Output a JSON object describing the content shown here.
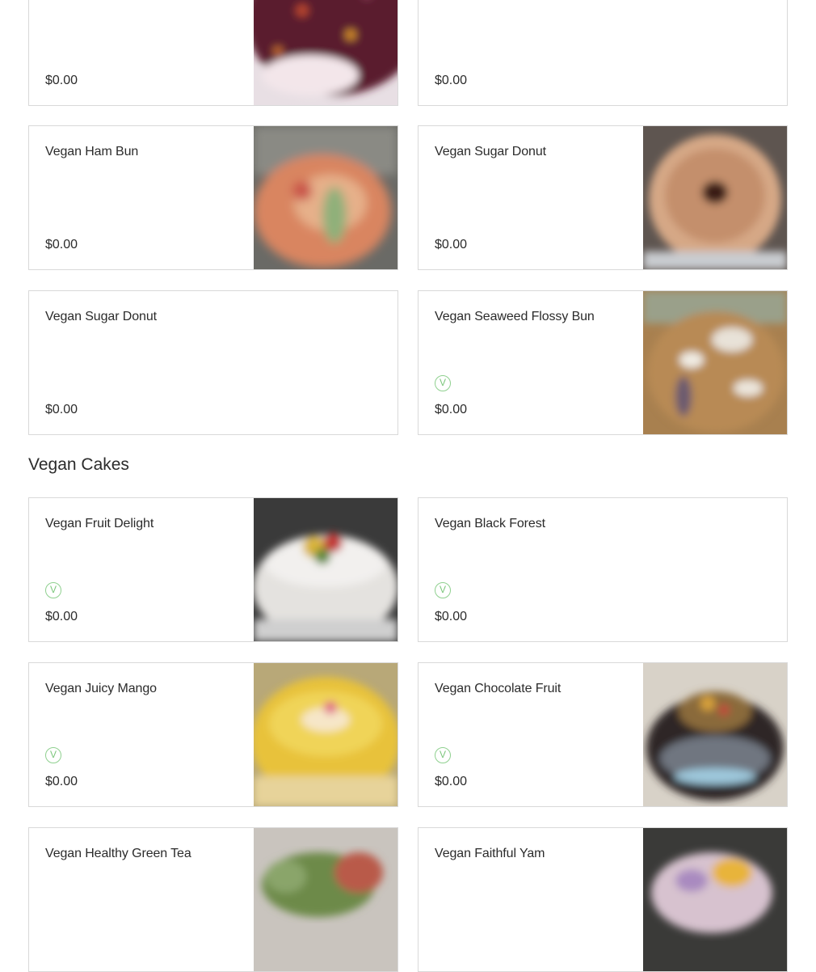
{
  "vegan_baked": {
    "items": [
      {
        "name": "",
        "price": "$0.00",
        "vegan_badge": false,
        "image": "chocolate-donut-photo"
      },
      {
        "name": "",
        "price": "$0.00",
        "vegan_badge": false,
        "image": null
      },
      {
        "name": "Vegan Ham Bun",
        "price": "$0.00",
        "vegan_badge": false,
        "image": "ham-bun-photo"
      },
      {
        "name": "Vegan Sugar Donut",
        "price": "$0.00",
        "vegan_badge": false,
        "image": "sugar-donut-photo"
      },
      {
        "name": "Vegan Sugar Donut",
        "price": "$0.00",
        "vegan_badge": false,
        "image": null
      },
      {
        "name": "Vegan Seaweed Flossy Bun",
        "price": "$0.00",
        "vegan_badge": true,
        "image": "seaweed-bun-photo"
      }
    ]
  },
  "vegan_cakes": {
    "title": "Vegan Cakes",
    "items": [
      {
        "name": "Vegan Fruit Delight",
        "price": "$0.00",
        "vegan_badge": true,
        "image": "fruit-cake-photo"
      },
      {
        "name": "Vegan Black Forest",
        "price": "$0.00",
        "vegan_badge": true,
        "image": null
      },
      {
        "name": "Vegan Juicy Mango",
        "price": "$0.00",
        "vegan_badge": true,
        "image": "mango-cake-photo"
      },
      {
        "name": "Vegan Chocolate Fruit",
        "price": "$0.00",
        "vegan_badge": true,
        "image": "chocolate-cake-photo"
      },
      {
        "name": "Vegan Healthy Green Tea",
        "price": "$0.00",
        "vegan_badge": false,
        "image": "green-tea-cake-photo"
      },
      {
        "name": "Vegan Faithful Yam",
        "price": "$0.00",
        "vegan_badge": false,
        "image": "yam-cake-photo"
      }
    ]
  },
  "badge": {
    "label": "V",
    "color": "#7cc67c",
    "icon": "vegan-badge-icon"
  },
  "colors": {
    "border": "#d9d9d9",
    "text": "#2b2b2b"
  }
}
